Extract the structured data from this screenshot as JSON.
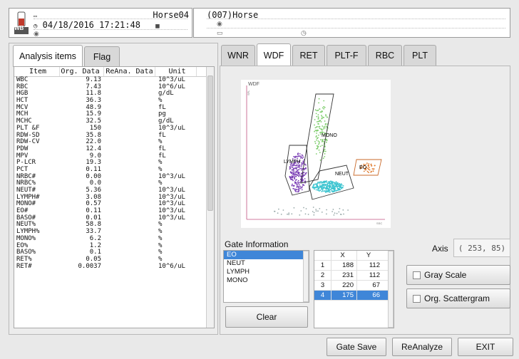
{
  "header": {
    "datetime": "04/18/2016 17:21:48",
    "sample_id": "Horse04",
    "species": "(007)Horse",
    "wb_badge": "WB"
  },
  "left_tabs": [
    {
      "label": "Analysis items",
      "active": true
    },
    {
      "label": "Flag",
      "active": false
    }
  ],
  "table": {
    "headers": [
      "Item",
      "Org. Data",
      "ReAna. Data",
      "Unit"
    ],
    "rows": [
      [
        "WBC",
        "9.13",
        "",
        "10^3/uL"
      ],
      [
        "RBC",
        "7.43",
        "",
        "10^6/uL"
      ],
      [
        "HGB",
        "11.8",
        "",
        "g/dL"
      ],
      [
        "HCT",
        "36.3",
        "",
        "%"
      ],
      [
        "MCV",
        "48.9",
        "",
        "fL"
      ],
      [
        "MCH",
        "15.9",
        "",
        "pg"
      ],
      [
        "MCHC",
        "32.5",
        "",
        "g/dL"
      ],
      [
        "PLT &F",
        "150",
        "",
        "10^3/uL"
      ],
      [
        "RDW-SD",
        "35.8",
        "",
        "fL"
      ],
      [
        "RDW-CV",
        "22.0",
        "",
        "%"
      ],
      [
        "PDW",
        "12.4",
        "",
        "fL"
      ],
      [
        "MPV",
        "9.0",
        "",
        "fL"
      ],
      [
        "P-LCR",
        "19.3",
        "",
        "%"
      ],
      [
        "PCT",
        "0.11",
        "",
        "%"
      ],
      [
        "NRBC#",
        "0.00",
        "",
        "10^3/uL"
      ],
      [
        "NRBC%",
        "0.0",
        "",
        "%"
      ],
      [
        "NEUT#",
        "5.36",
        "",
        "10^3/uL"
      ],
      [
        "LYMPH#",
        "3.08",
        "",
        "10^3/uL"
      ],
      [
        "MONO#",
        "0.57",
        "",
        "10^3/uL"
      ],
      [
        "EO#",
        "0.11",
        "",
        "10^3/uL"
      ],
      [
        "BASO#",
        "0.01",
        "",
        "10^3/uL"
      ],
      [
        "NEUT%",
        "58.8",
        "",
        "%"
      ],
      [
        "LYMPH%",
        "33.7",
        "",
        "%"
      ],
      [
        "MONO%",
        "6.2",
        "",
        "%"
      ],
      [
        "EO%",
        "1.2",
        "",
        "%"
      ],
      [
        "BASO%",
        "0.1",
        "",
        "%"
      ],
      [
        "RET%",
        "0.05",
        "",
        "%"
      ],
      [
        "RET#",
        "0.0037",
        "",
        "10^6/uL"
      ]
    ]
  },
  "right_tabs": [
    {
      "label": "WNR",
      "active": false
    },
    {
      "label": "WDF",
      "active": true
    },
    {
      "label": "RET",
      "active": false
    },
    {
      "label": "PLT-F",
      "active": false
    },
    {
      "label": "RBC",
      "active": false
    },
    {
      "label": "PLT",
      "active": false
    }
  ],
  "scattergram": {
    "title": "WDF",
    "y_axis": "SFL",
    "x_axis": "SSC",
    "gates": [
      "MONO",
      "LYMPH",
      "NEUT",
      "EO"
    ]
  },
  "gate_info": {
    "title": "Gate Information",
    "items": [
      "EO",
      "NEUT",
      "LYMPH",
      "MONO"
    ],
    "selected": "EO",
    "clear_label": "Clear",
    "columns": [
      "",
      "X",
      "Y"
    ],
    "points": [
      [
        "1",
        "188",
        "112"
      ],
      [
        "2",
        "231",
        "112"
      ],
      [
        "3",
        "220",
        "67"
      ],
      [
        "4",
        "175",
        "66"
      ]
    ]
  },
  "axis": {
    "label": "Axis",
    "value": "( 253,  85)"
  },
  "options": {
    "gray_scale": "Gray Scale",
    "org_scattergram": "Org. Scattergram"
  },
  "buttons": {
    "gate_save": "Gate Save",
    "reanalyze": "ReAnalyze",
    "exit": "EXIT"
  },
  "colors": {
    "selection": "#3f86d8",
    "lymph": "#7b3fb5",
    "neut": "#3cc4d0",
    "mono": "#7ccc6a",
    "eo": "#e0782a"
  }
}
